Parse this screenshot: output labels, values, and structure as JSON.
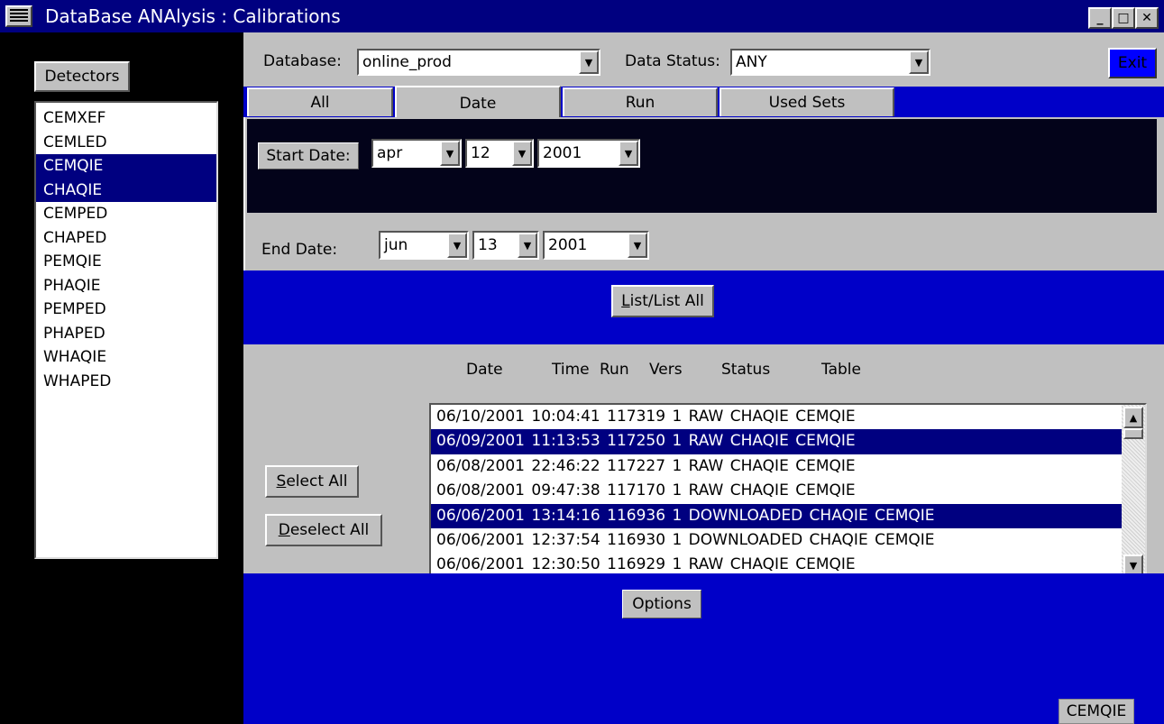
{
  "window": {
    "title": "DataBase ANAlysis : Calibrations",
    "minimize_label": "_",
    "maximize_label": "□",
    "close_label": "✕",
    "menu_icon": "hamburger-icon"
  },
  "header": {
    "database_label": "Database:",
    "database_value": "online_prod",
    "status_label": "Data Status:",
    "status_value": "ANY",
    "exit_label": "Exit"
  },
  "sidebar": {
    "detectors_button": "Detectors",
    "items": [
      {
        "label": "CEMXEF",
        "selected": false
      },
      {
        "label": "CEMLED",
        "selected": false
      },
      {
        "label": "CEMQIE",
        "selected": true
      },
      {
        "label": "CHAQIE",
        "selected": true
      },
      {
        "label": "CEMPED",
        "selected": false
      },
      {
        "label": "CHAPED",
        "selected": false
      },
      {
        "label": "PEMQIE",
        "selected": false
      },
      {
        "label": "PHAQIE",
        "selected": false
      },
      {
        "label": "PEMPED",
        "selected": false
      },
      {
        "label": "PHAPED",
        "selected": false
      },
      {
        "label": "WHAQIE",
        "selected": false
      },
      {
        "label": "WHAPED",
        "selected": false
      }
    ]
  },
  "tabs": [
    {
      "label": "All",
      "active": false
    },
    {
      "label": "Date",
      "active": true
    },
    {
      "label": "Run",
      "active": false
    },
    {
      "label": "Used Sets",
      "active": false
    }
  ],
  "date_filter": {
    "start_label": "Start Date:",
    "start_month": "apr",
    "start_day": "12",
    "start_year": "2001",
    "end_label": "End Date:",
    "end_month": "jun",
    "end_day": "13",
    "end_year": "2001"
  },
  "list_button": {
    "mnemonic": "L",
    "rest": "ist/List All"
  },
  "results": {
    "headers": [
      "Date",
      "Time",
      "Run",
      "Vers",
      "Status",
      "Table"
    ],
    "rows": [
      {
        "text": "06/10/2001 10:04:41  117319  1  RAW  CHAQIE  CEMQIE",
        "selected": false
      },
      {
        "text": "06/09/2001 11:13:53  117250  1  RAW  CHAQIE  CEMQIE",
        "selected": true
      },
      {
        "text": "06/08/2001 22:46:22  117227  1  RAW  CHAQIE  CEMQIE",
        "selected": false
      },
      {
        "text": "06/08/2001 09:47:38  117170  1  RAW  CHAQIE  CEMQIE",
        "selected": false
      },
      {
        "text": "06/06/2001 13:14:16  116936  1  DOWNLOADED  CHAQIE  CEMQIE",
        "selected": true
      },
      {
        "text": "06/06/2001 12:37:54  116930  1  DOWNLOADED  CHAQIE  CEMQIE",
        "selected": false
      },
      {
        "text": "06/06/2001 12:30:50  116929  1  RAW  CHAQIE  CEMQIE",
        "selected": false
      }
    ]
  },
  "actions": {
    "select_all": {
      "mnemonic": "S",
      "rest": "elect All"
    },
    "deselect_all": {
      "mnemonic": "D",
      "rest": "eselect All"
    },
    "options_label": "Options"
  },
  "status_tag": "CEMQIE",
  "colors": {
    "title_blue": "#000080",
    "panel_blue": "#0000c8",
    "panel_gray": "#c0c0c0",
    "selection": "#000080",
    "dark_panel": "#03031a"
  }
}
